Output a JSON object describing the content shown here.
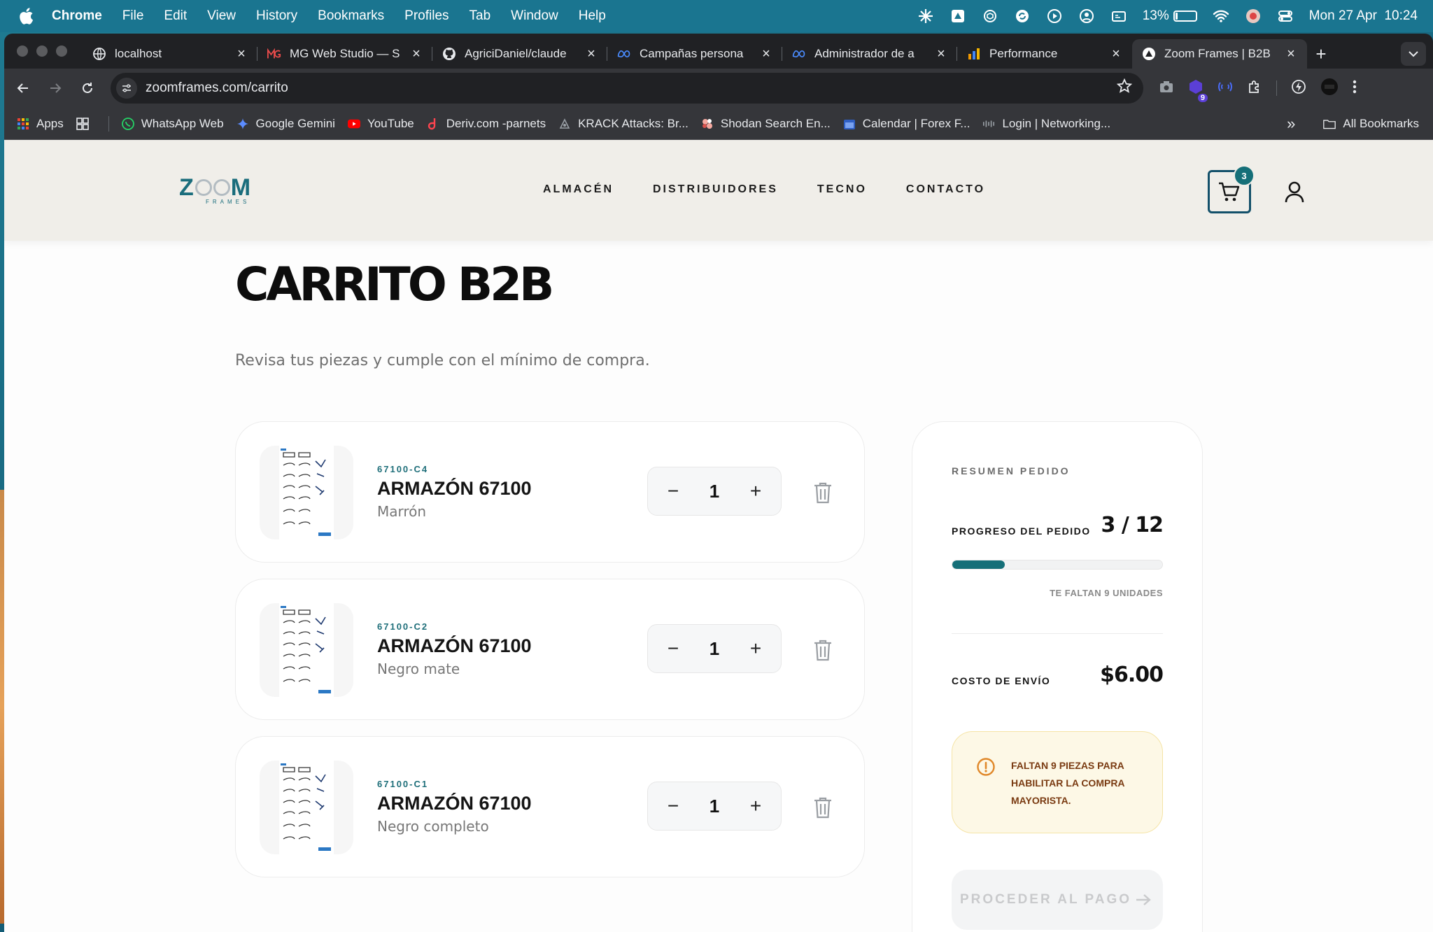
{
  "menubar": {
    "app": "Chrome",
    "items": [
      "File",
      "Edit",
      "View",
      "History",
      "Bookmarks",
      "Profiles",
      "Tab",
      "Window",
      "Help"
    ],
    "battery": "13%",
    "battery_level": 0.13,
    "datetime": "Mon 27 Apr  10:24"
  },
  "tabs": [
    {
      "title": "localhost",
      "icon": "globe-icon"
    },
    {
      "title": "MG Web Studio — S",
      "icon": "mg-logo-icon"
    },
    {
      "title": "AgriciDaniel/claude",
      "icon": "github-icon"
    },
    {
      "title": "Campañas persona",
      "icon": "meta-icon"
    },
    {
      "title": "Administrador de a",
      "icon": "meta-icon"
    },
    {
      "title": "Performance",
      "icon": "analytics-icon"
    },
    {
      "title": "Zoom Frames | B2B",
      "icon": "triangle-icon",
      "active": true
    }
  ],
  "address": {
    "url": "zoomframes.com/carrito",
    "extension_badge": "9"
  },
  "bookmarks": [
    {
      "label": "Apps",
      "icon": "apps-grid-icon"
    },
    {
      "label": "WhatsApp Web",
      "icon": "whatsapp-icon"
    },
    {
      "label": "Google Gemini",
      "icon": "gemini-icon"
    },
    {
      "label": "YouTube",
      "icon": "youtube-icon"
    },
    {
      "label": "Deriv.com -parnets",
      "icon": "deriv-icon"
    },
    {
      "label": "KRACK Attacks: Br...",
      "icon": "krack-icon"
    },
    {
      "label": "Shodan Search En...",
      "icon": "shodan-icon"
    },
    {
      "label": "Calendar | Forex F...",
      "icon": "calendar-icon"
    },
    {
      "label": "Login | Networking...",
      "icon": "cisco-icon"
    }
  ],
  "bookmarks_more": "»",
  "all_bookmarks": "All Bookmarks",
  "site": {
    "logo": {
      "word_start": "Z",
      "word_end": "M",
      "sub": "FRAMES"
    },
    "nav": [
      "ALMACÉN",
      "DISTRIBUIDORES",
      "TECNO",
      "CONTACTO"
    ],
    "cart_count": "3"
  },
  "page": {
    "title": "CARRITO B2B",
    "subtitle": "Revisa tus piezas y cumple con el mínimo de compra."
  },
  "cart_items": [
    {
      "sku": "67100-C4",
      "name": "ARMAZÓN 67100",
      "variant": "Marrón",
      "qty": "1"
    },
    {
      "sku": "67100-C2",
      "name": "ARMAZÓN 67100",
      "variant": "Negro mate",
      "qty": "1"
    },
    {
      "sku": "67100-C1",
      "name": "ARMAZÓN 67100",
      "variant": "Negro completo",
      "qty": "1"
    }
  ],
  "stepper": {
    "minus": "−",
    "plus": "+"
  },
  "summary": {
    "title": "RESUMEN PEDIDO",
    "progress_label": "PROGRESO DEL PEDIDO",
    "progress_value": "3 / 12",
    "progress_fraction": 0.25,
    "remaining": "TE FALTAN 9 UNIDADES",
    "shipping_label": "COSTO DE ENVÍO",
    "shipping_value": "$6.00",
    "warning": "FALTAN 9 PIEZAS PARA HABILITAR LA COMPRA MAYORISTA.",
    "pay_button": "PROCEDER AL PAGO"
  },
  "colors": {
    "accent": "#156f78",
    "navy": "#13506a",
    "warning_bg": "#fdf8e6",
    "warning_text": "#7a3b12"
  }
}
